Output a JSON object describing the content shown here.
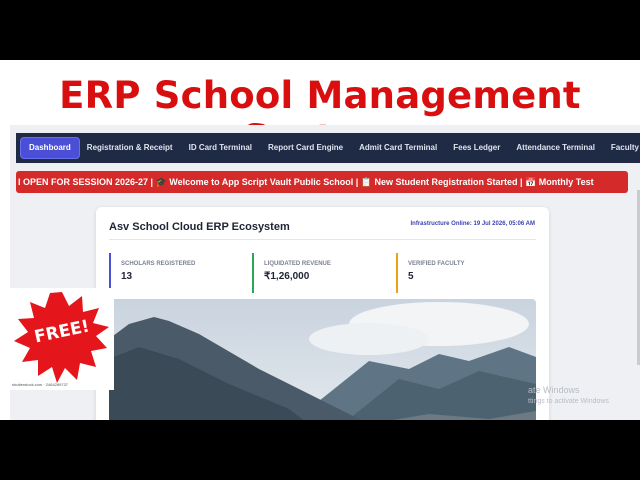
{
  "headline": "ERP School Management System",
  "nav": {
    "items": [
      {
        "label": "Dashboard",
        "active": true
      },
      {
        "label": "Registration & Receipt",
        "active": false
      },
      {
        "label": "ID Card Terminal",
        "active": false
      },
      {
        "label": "Report Card Engine",
        "active": false
      },
      {
        "label": "Admit Card Terminal",
        "active": false
      },
      {
        "label": "Fees Ledger",
        "active": false
      },
      {
        "label": "Attendance Terminal",
        "active": false
      },
      {
        "label": "Faculty Ma",
        "active": false
      }
    ]
  },
  "ticker": {
    "text": "I OPEN FOR SESSION 2026-27 | 🎓 Welcome to App Script Vault Public School | 📋 New Student Registration Started | 📅 Monthly Test"
  },
  "dashboard": {
    "title": "Asv School Cloud ERP Ecosystem",
    "infrastructure": "Infrastructure Online: 19 Jul 2026, 05:06 AM",
    "stats": [
      {
        "label": "SCHOLARS REGISTERED",
        "value": "13",
        "accent": "#4a4fd6"
      },
      {
        "label": "LIQUIDATED REVENUE",
        "value": "₹1,26,000",
        "accent": "#2aa85a"
      },
      {
        "label": "VERIFIED FACULTY",
        "value": "5",
        "accent": "#e8a317"
      }
    ]
  },
  "badge": {
    "text": "FREE!",
    "stock_id": "shutterstock.com · 2464289737"
  },
  "watermark": {
    "line1": "ate Windows",
    "line2": "ttings to activate Windows"
  },
  "colors": {
    "headline": "#d90f0f",
    "navbar": "#1f2a44",
    "nav_active": "#4a4fd6",
    "ticker": "#d42a2a",
    "badge": "#e4161b"
  }
}
